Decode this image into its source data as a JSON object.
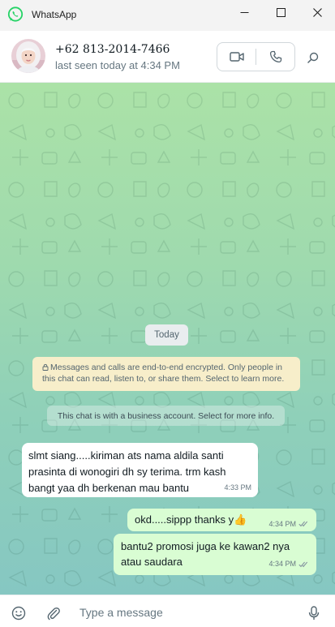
{
  "window": {
    "title": "WhatsApp"
  },
  "contact": {
    "name": "+62 813-2014-7466",
    "status": "last seen today at 4:34 PM"
  },
  "chat": {
    "date_separator": "Today",
    "encryption_notice": "Messages and calls are end-to-end encrypted. Only people in this chat can read, listen to, or share them. Select to learn more.",
    "business_notice": "This chat is with a business account. Select for more info.",
    "messages": [
      {
        "direction": "incoming",
        "text": "slmt siang.....kiriman ats nama aldila santi prasinta di wonogiri dh sy terima. trm kash bangt yaa dh berkenan mau bantu",
        "time": "4:33 PM"
      },
      {
        "direction": "outgoing",
        "text": "okd.....sippp thanks y👍",
        "time": "4:34 PM",
        "status": "read"
      },
      {
        "direction": "outgoing",
        "text": "bantu2 promosi juga ke kawan2 nya atau saudara",
        "time": "4:34 PM",
        "status": "read"
      }
    ]
  },
  "composer": {
    "placeholder": "Type a message"
  },
  "icons": {
    "app": "whatsapp-logo-icon",
    "video_call": "video-camera-icon",
    "voice_call": "phone-icon",
    "search": "search-icon",
    "emoji": "emoji-icon",
    "attach": "paperclip-icon",
    "voice_note": "microphone-icon",
    "read_receipt": "double-check-icon"
  },
  "colors": {
    "brand": "#25d366",
    "outgoing_bubble": "#d9fdd3",
    "incoming_bubble": "#ffffff",
    "read_tick": "#8696a0"
  }
}
